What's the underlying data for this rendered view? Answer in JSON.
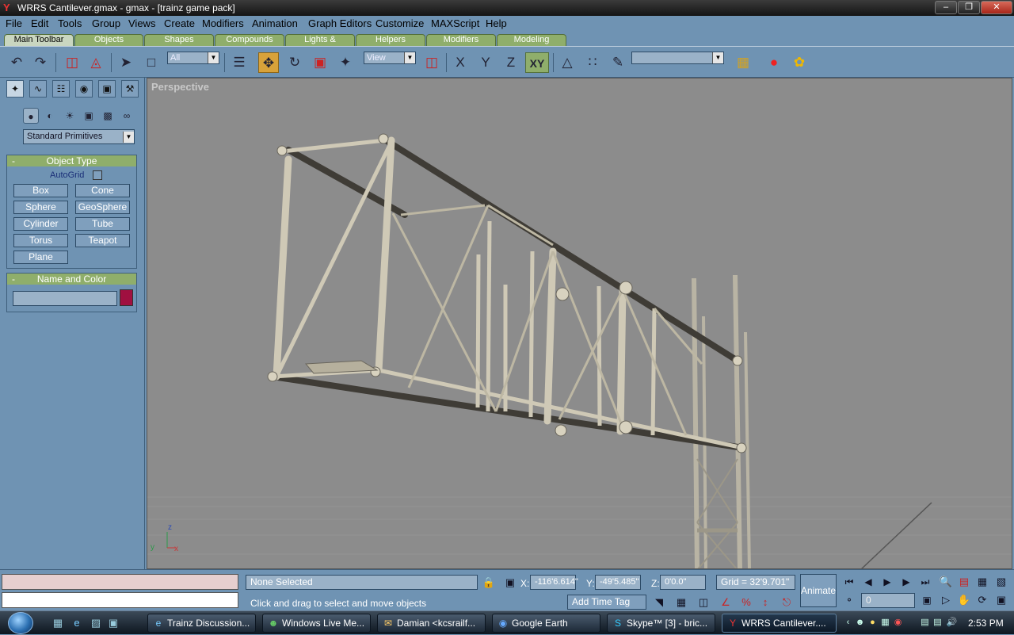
{
  "window": {
    "title": "WRRS Cantilever.gmax - gmax - [trainz game pack]"
  },
  "menu": [
    "File",
    "Edit",
    "Tools",
    "Group",
    "Views",
    "Create",
    "Modifiers",
    "Animation",
    "Graph Editors",
    "Customize",
    "MAXScript",
    "Help"
  ],
  "tabs": [
    "Main Toolbar",
    "Objects",
    "Shapes",
    "Compounds",
    "Lights & Cameras",
    "Helpers",
    "Modifiers",
    "Modeling"
  ],
  "toolbar": {
    "selection_filter": "All",
    "reference_coord": "View",
    "axis_x": "X",
    "axis_y": "Y",
    "axis_z": "Z",
    "axis_xy": "XY"
  },
  "command_panel": {
    "category": "Standard Primitives",
    "object_type": {
      "title": "Object Type",
      "autogrid_label": "AutoGrid",
      "buttons": [
        "Box",
        "Cone",
        "Sphere",
        "GeoSphere",
        "Cylinder",
        "Tube",
        "Torus",
        "Teapot",
        "Plane"
      ]
    },
    "name_and_color": {
      "title": "Name and Color",
      "color": "#a01040"
    }
  },
  "viewport": {
    "label": "Perspective"
  },
  "status": {
    "selection": "None Selected",
    "prompt": "Click and drag to select and move objects",
    "x_label": "X:",
    "x_value": "-116'6.614\"",
    "y_label": "Y:",
    "y_value": "-49'5.485\"",
    "z_label": "Z:",
    "z_value": "0'0.0\"",
    "grid": "Grid = 32'9.701\"",
    "add_time_tag": "Add Time Tag",
    "animate": "Animate",
    "frame": "0"
  },
  "taskbar": {
    "items": [
      "Trainz Discussion...",
      "Windows Live Me...",
      "Damian <kcsrailf...",
      "Google Earth",
      "Skype™ [3] - bric...",
      "WRRS Cantilever...."
    ],
    "clock": "2:53 PM"
  }
}
